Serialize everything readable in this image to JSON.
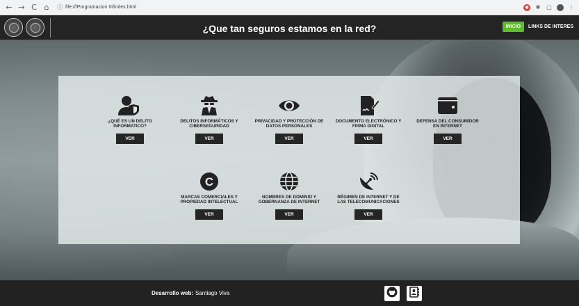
{
  "browser": {
    "back": "←",
    "forward": "→",
    "reload": "C",
    "home": "⌂",
    "url": "file:///Porgramacion III/index.html"
  },
  "header": {
    "title": "¿Que tan seguros estamos en la red?",
    "inicio_label": "INICIO",
    "links_label": "LINKS DE INTERES",
    "accent_color": "#5cbf2a"
  },
  "cards": [
    {
      "label": "¿QUÉ ES UN DELITO INFORMATICO?",
      "icon": "user-shield-icon",
      "button": "VER"
    },
    {
      "label": "DELITOS INFORMÁTICOS Y CIBERSEGURIDAD",
      "icon": "spy-icon",
      "button": "VER"
    },
    {
      "label": "PRIVACIDAD Y PROTECCIÓN DE DATOS PERSONALES",
      "icon": "eye-icon",
      "button": "VER"
    },
    {
      "label": "DOCUMENTO ELECTRÓNICO Y FIRMA DIGITAL",
      "icon": "file-signature-icon",
      "button": "VER"
    },
    {
      "label": "DEFENSA DEL CONSUMIDOR EN INTERNET",
      "icon": "wallet-icon",
      "button": "VER"
    },
    {
      "label": "MARCAS COMERCIALES Y PROPIEDAD INTELECTUAL",
      "icon": "copyright-icon",
      "button": "VER"
    },
    {
      "label": "NOMBRES DE DOMINIO Y GOBERNANZA DE INTERNET",
      "icon": "globe-icon",
      "button": "VER"
    },
    {
      "label": "RÉGIMEN DE INTERNET Y DE LAS TELECOMUNICACIONES",
      "icon": "satellite-dish-icon",
      "button": "VER"
    }
  ],
  "footer": {
    "credit_label": "Desarrollo web:",
    "credit_name": "Santiago Viva"
  }
}
